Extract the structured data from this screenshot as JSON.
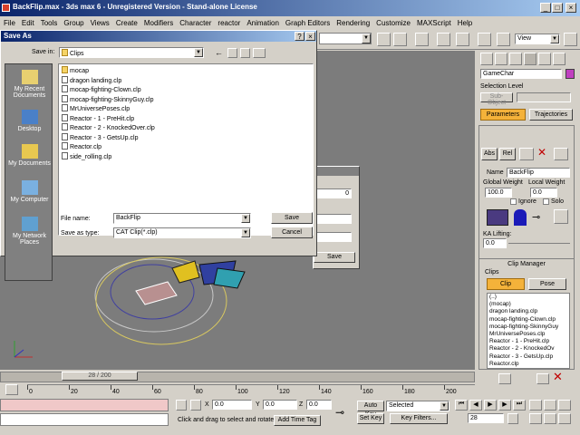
{
  "app": {
    "title": "BackFlip.max - 3ds max 6 - Unregistered Version - Stand-alone License",
    "win_min": "_",
    "win_max": "□",
    "win_close": "×"
  },
  "menu": [
    "File",
    "Edit",
    "Tools",
    "Group",
    "Views",
    "Create",
    "Modifiers",
    "Character",
    "reactor",
    "Animation",
    "Graph Editors",
    "Rendering",
    "Customize",
    "MAXScript",
    "Help"
  ],
  "toolbar": {
    "view_select": "View"
  },
  "save_dialog": {
    "title": "Save As",
    "help": "?",
    "close": "×",
    "save_in_label": "Save in:",
    "save_in_value": "Clips",
    "places": [
      "My Recent Documents",
      "Desktop",
      "My Documents",
      "My Computer",
      "My Network Places"
    ],
    "files": [
      {
        "name": "mocap",
        "type": "folder"
      },
      {
        "name": "dragon landing.clp",
        "type": "file"
      },
      {
        "name": "mocap-fighting-Clown.clp",
        "type": "file"
      },
      {
        "name": "mocap-fighting-SkinnyGuy.clp",
        "type": "file"
      },
      {
        "name": "MrUniversePoses.clp",
        "type": "file"
      },
      {
        "name": "Reactor - 1 - PreHit.clp",
        "type": "file"
      },
      {
        "name": "Reactor - 2 - KnockedOver.clp",
        "type": "file"
      },
      {
        "name": "Reactor - 3 - GetsUp.clp",
        "type": "file"
      },
      {
        "name": "Reactor.clp",
        "type": "file"
      },
      {
        "name": "side_rolling.clp",
        "type": "file"
      }
    ],
    "filename_label": "File name:",
    "filename_value": "BackFlip",
    "savetype_label": "Save as type:",
    "savetype_value": "CAT Clip(*.clp)",
    "save_button": "Save",
    "cancel_button": "Cancel"
  },
  "behind_dialog": {
    "save_button": "Save",
    "field_value": "0"
  },
  "command_panel": {
    "object_name": "GameChar",
    "selection_level_label": "Selection Level",
    "sub_object": "Sub-Object",
    "tab_parameters": "Parameters",
    "tab_trajectories": "Trajectories",
    "abs_button": "Abs",
    "rel_button": "Rel",
    "name_label": "Name",
    "name_value": "BackFlip",
    "global_weight_label": "Global Weight",
    "local_weight_label": "Local Weight",
    "global_weight_value": "100.0",
    "local_weight_value": "0.0",
    "ignore_label": "Ignore",
    "solo_label": "Solo",
    "ka_lifting_label": "KA Lifting:",
    "ka_lifting_value": "0.0",
    "clip_manager_title": "Clip Manager",
    "clips_label": "Clips",
    "clip_button": "Clip",
    "pose_button": "Pose",
    "clip_items": [
      "(..)",
      "(mocap)",
      "dragon landing.clp",
      "mocap-fighting-Clown.clp",
      "mocap-fighting-SkinnyGuy",
      "MrUniversePoses.clp",
      "Reactor - 1 - PreHit.clp",
      "Reactor - 2 - KnockedOv",
      "Reactor - 3 - GetsUp.clp",
      "Reactor.clp"
    ]
  },
  "timeline": {
    "slider_label": "28 / 200",
    "ticks": [
      "0",
      "20",
      "40",
      "60",
      "80",
      "100",
      "120",
      "140",
      "160",
      "180",
      "200"
    ]
  },
  "status": {
    "x_label": "X",
    "x_value": "0.0",
    "y_label": "Y",
    "y_value": "0.0",
    "z_label": "Z",
    "z_value": "0.0",
    "prompt": "Click and drag to select and rotate",
    "add_time_tag": "Add Time Tag",
    "auto_key": "Auto Key",
    "selected": "Selected",
    "set_key": "Set Key",
    "key_filters": "Key Filters...",
    "frame_value": "28"
  }
}
